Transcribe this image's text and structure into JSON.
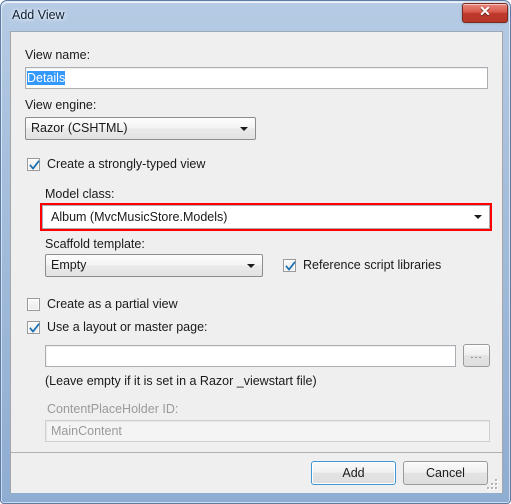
{
  "window": {
    "title": "Add View",
    "close_label": "✕"
  },
  "form": {
    "view_name_label": "View name:",
    "view_name_value": "Details",
    "view_engine_label": "View engine:",
    "view_engine_value": "Razor (CSHTML)",
    "strongly_typed_label": "Create a strongly-typed view",
    "strongly_typed_checked": true,
    "model_class_label": "Model class:",
    "model_class_value": "Album (MvcMusicStore.Models)",
    "scaffold_label": "Scaffold template:",
    "scaffold_value": "Empty",
    "reference_scripts_label": "Reference script libraries",
    "reference_scripts_checked": true,
    "partial_view_label": "Create as a partial view",
    "partial_view_checked": false,
    "layout_label": "Use a layout or master page:",
    "layout_checked": true,
    "layout_path_value": "",
    "browse_label": "...",
    "layout_hint": "(Leave empty if it is set in a Razor _viewstart file)",
    "placeholder_label": "ContentPlaceHolder ID:",
    "placeholder_value": "MainContent"
  },
  "footer": {
    "add_label": "Add",
    "cancel_label": "Cancel"
  },
  "colors": {
    "accent_red": "#ff0000",
    "selection_blue": "#3399ff",
    "default_button_border": "#3c97d4"
  }
}
